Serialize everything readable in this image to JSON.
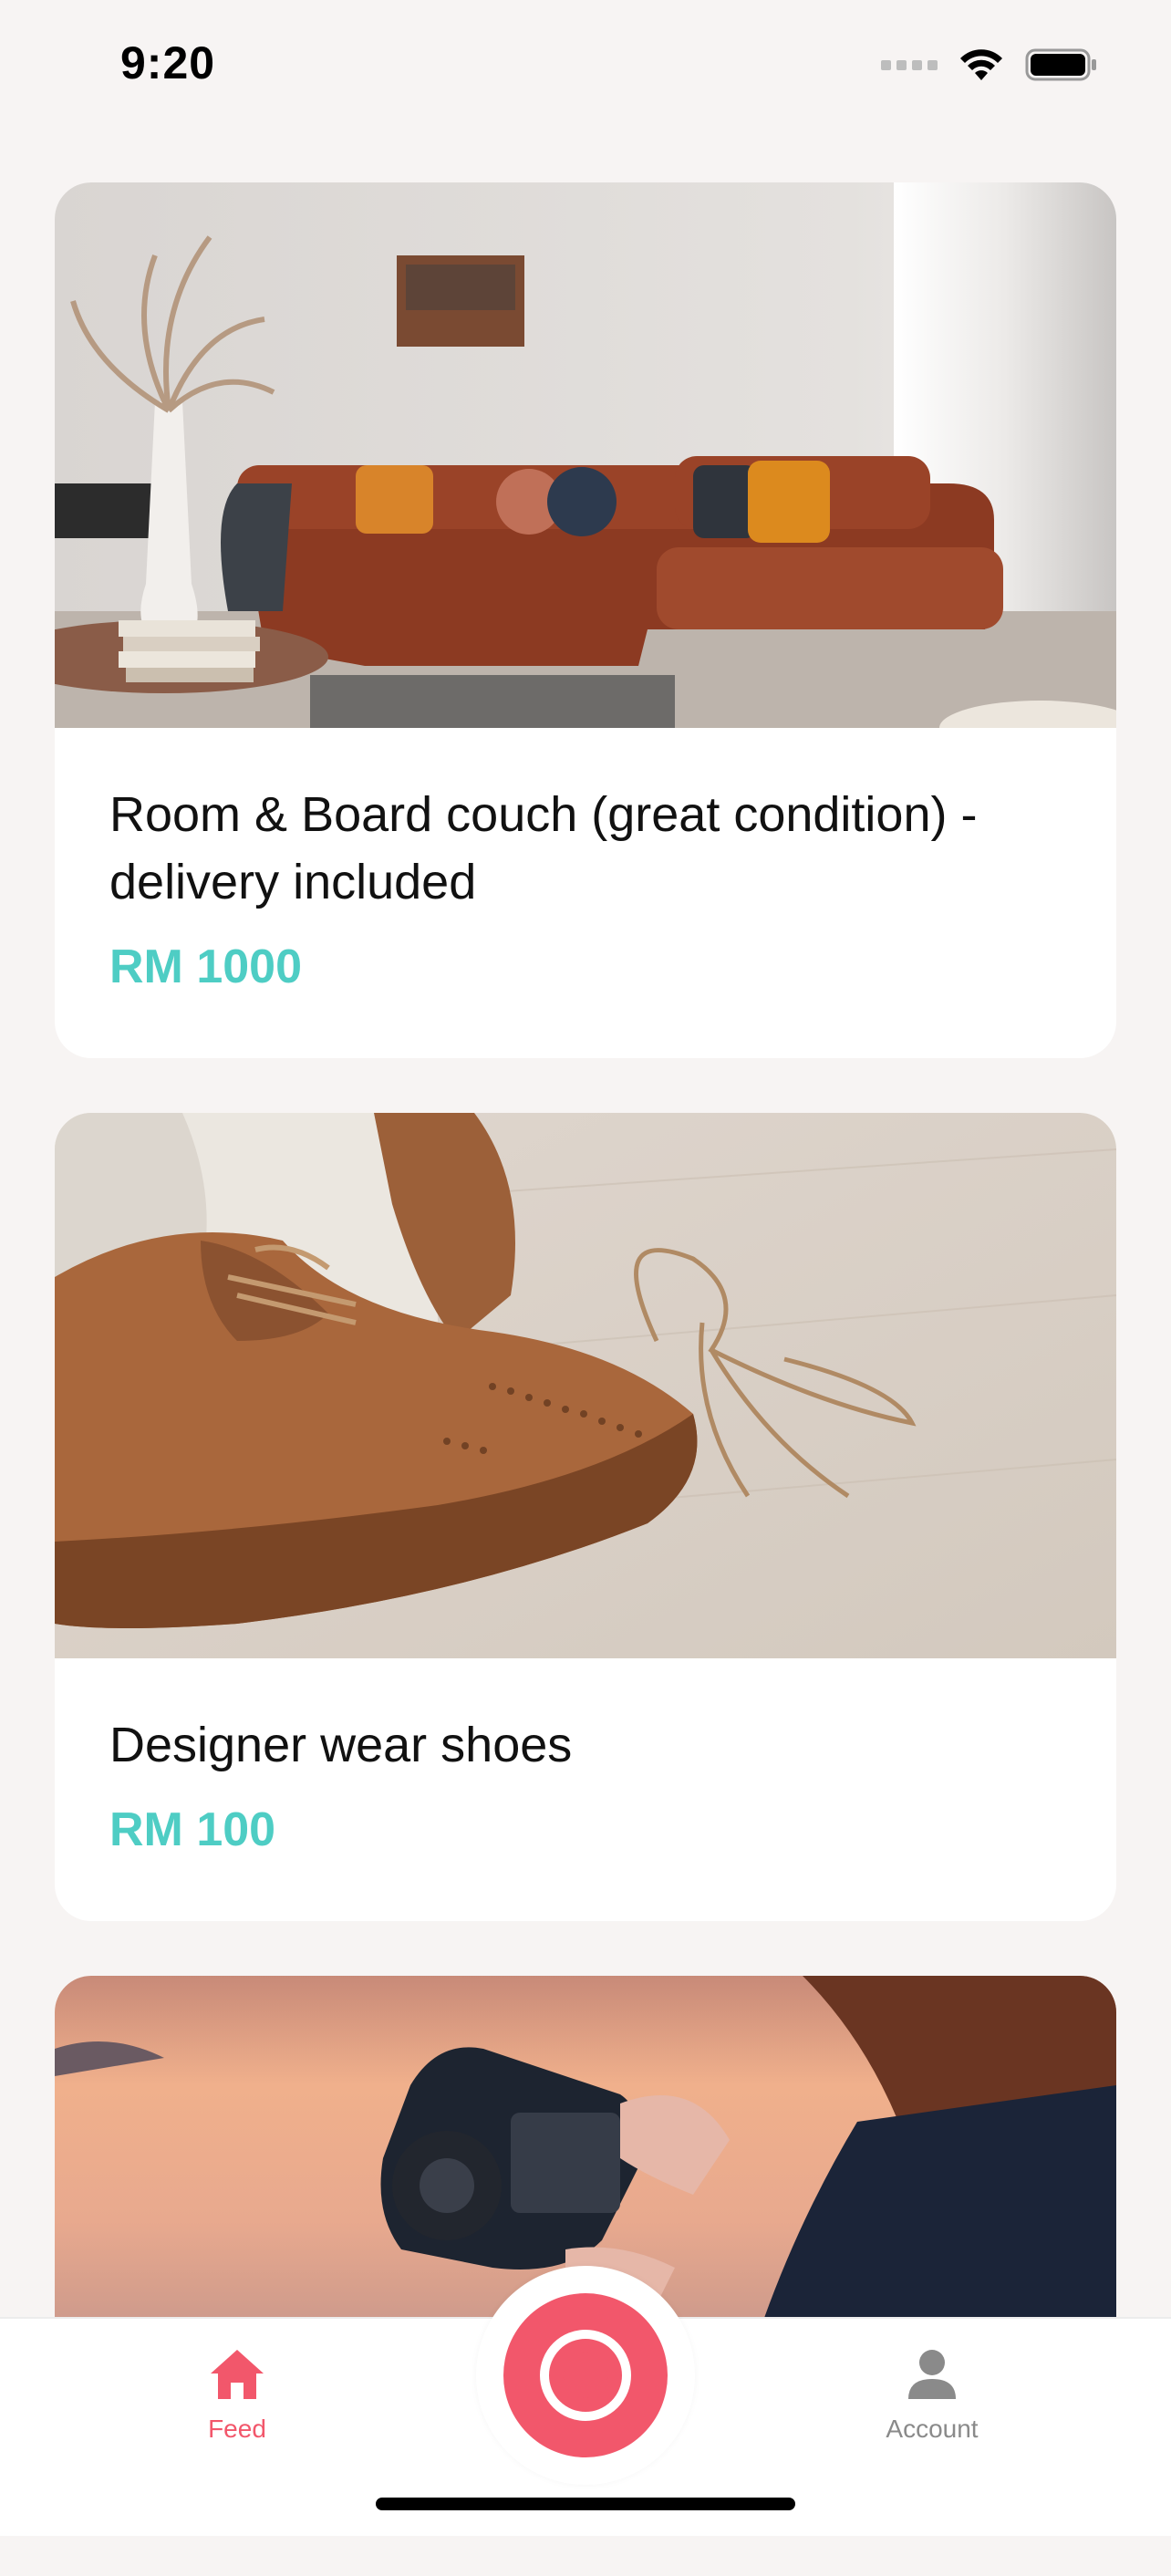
{
  "status_bar": {
    "time": "9:20",
    "icons": [
      "cellular-signal-icon",
      "wifi-icon",
      "battery-icon"
    ]
  },
  "listings": [
    {
      "title": "Room & Board couch (great condition) - delivery included",
      "price": "RM 1000",
      "image": "living-room-couch-photo"
    },
    {
      "title": "Designer wear shoes",
      "price": "RM 100",
      "image": "brown-brogue-shoes-photo"
    },
    {
      "title": "",
      "price": "",
      "image": "camera-at-sunset-photo"
    }
  ],
  "tab_bar": {
    "feed_label": "Feed",
    "account_label": "Account",
    "add_icon": "plus-icon"
  },
  "colors": {
    "accent": "#f2576b",
    "price": "#4ecdc4",
    "background": "#f7f4f3",
    "inactive": "#8a8a8a"
  }
}
